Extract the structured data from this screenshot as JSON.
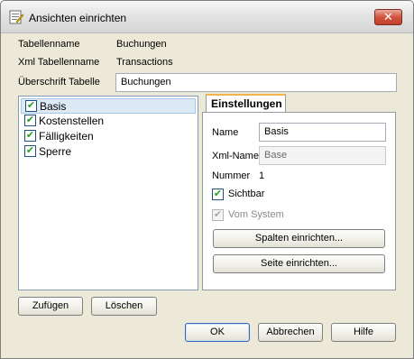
{
  "window": {
    "title": "Ansichten einrichten",
    "close_label": "✕"
  },
  "fields": {
    "tablename_label": "Tabellenname",
    "tablename_value": "Buchungen",
    "xml_tablename_label": "Xml Tabellenname",
    "xml_tablename_value": "Transactions",
    "caption_label": "Überschrift Tabelle",
    "caption_value": "Buchungen"
  },
  "views_list": [
    {
      "label": "Basis",
      "checked": true,
      "selected": true
    },
    {
      "label": "Kostenstellen",
      "checked": true,
      "selected": false
    },
    {
      "label": "Fälligkeiten",
      "checked": true,
      "selected": false
    },
    {
      "label": "Sperre",
      "checked": true,
      "selected": false
    }
  ],
  "settings": {
    "tab_label": "Einstellungen",
    "name_label": "Name",
    "name_value": "Basis",
    "xml_name_label": "Xml-Name",
    "xml_name_value": "Base",
    "number_label": "Nummer",
    "number_value": "1",
    "visible_label": "Sichtbar",
    "visible_checked": true,
    "system_label": "Vom System",
    "system_checked": true,
    "columns_button": "Spalten einrichten...",
    "page_button": "Seite einrichten..."
  },
  "buttons": {
    "add": "Zufügen",
    "delete": "Löschen",
    "ok": "OK",
    "cancel": "Abbrechen",
    "help": "Hilfe"
  },
  "icons": {
    "title": "settings-dialog-icon",
    "check": "check-icon",
    "close": "close-icon"
  }
}
